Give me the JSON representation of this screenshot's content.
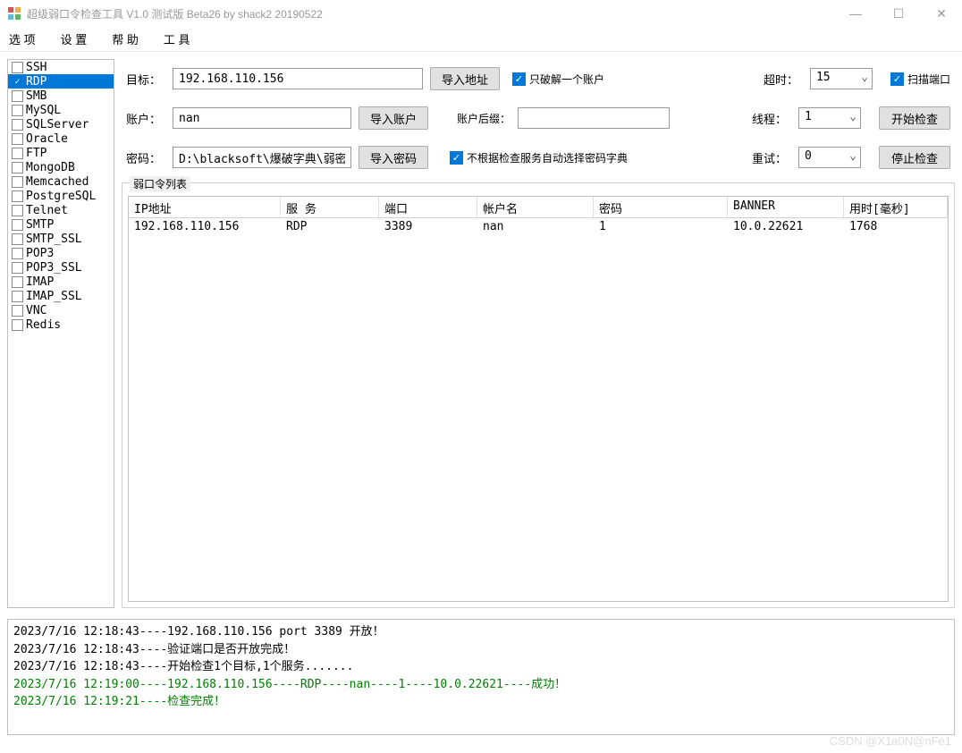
{
  "window": {
    "title": "超级弱口令检查工具 V1.0 测试版 Beta26 by shack2 20190522"
  },
  "menu": {
    "options": "选 项",
    "settings": "设 置",
    "help": "帮 助",
    "tools": "工 具"
  },
  "protocols": [
    {
      "label": "SSH",
      "checked": false,
      "selected": false
    },
    {
      "label": "RDP",
      "checked": true,
      "selected": true
    },
    {
      "label": "SMB",
      "checked": false,
      "selected": false
    },
    {
      "label": "MySQL",
      "checked": false,
      "selected": false
    },
    {
      "label": "SQLServer",
      "checked": false,
      "selected": false
    },
    {
      "label": "Oracle",
      "checked": false,
      "selected": false
    },
    {
      "label": "FTP",
      "checked": false,
      "selected": false
    },
    {
      "label": "MongoDB",
      "checked": false,
      "selected": false
    },
    {
      "label": "Memcached",
      "checked": false,
      "selected": false
    },
    {
      "label": "PostgreSQL",
      "checked": false,
      "selected": false
    },
    {
      "label": "Telnet",
      "checked": false,
      "selected": false
    },
    {
      "label": "SMTP",
      "checked": false,
      "selected": false
    },
    {
      "label": "SMTP_SSL",
      "checked": false,
      "selected": false
    },
    {
      "label": "POP3",
      "checked": false,
      "selected": false
    },
    {
      "label": "POP3_SSL",
      "checked": false,
      "selected": false
    },
    {
      "label": "IMAP",
      "checked": false,
      "selected": false
    },
    {
      "label": "IMAP_SSL",
      "checked": false,
      "selected": false
    },
    {
      "label": "VNC",
      "checked": false,
      "selected": false
    },
    {
      "label": "Redis",
      "checked": false,
      "selected": false
    }
  ],
  "form": {
    "target_label": "目标：",
    "target_value": "192.168.110.156",
    "import_target": "导入地址",
    "single_account": "只破解一个账户",
    "timeout_label": "超时：",
    "timeout_value": "15",
    "scan_port": "扫描端口",
    "user_label": "账户：",
    "user_value": "nan",
    "import_user": "导入账户",
    "user_suffix_label": "账户后缀：",
    "user_suffix_value": "",
    "threads_label": "线程：",
    "threads_value": "1",
    "start_check": "开始检查",
    "pwd_label": "密码：",
    "pwd_value": "D:\\blacksoft\\爆破字典\\弱密",
    "import_pwd": "导入密码",
    "no_auto_dict": "不根据检查服务自动选择密码字典",
    "retry_label": "重试：",
    "retry_value": "0",
    "stop_check": "停止检查"
  },
  "results": {
    "legend": "弱口令列表",
    "headers": {
      "ip": "IP地址",
      "service": "服 务",
      "port": "端口",
      "user": "帐户名",
      "pwd": "密码",
      "banner": "BANNER",
      "time": "用时[毫秒]"
    },
    "rows": [
      {
        "ip": "192.168.110.156",
        "service": "RDP",
        "port": "3389",
        "user": "nan",
        "pwd": "1",
        "banner": "10.0.22621",
        "time": "1768"
      }
    ]
  },
  "log": [
    {
      "text": "2023/7/16 12:18:43----192.168.110.156 port 3389 开放！",
      "color": "black"
    },
    {
      "text": "2023/7/16 12:18:43----验证端口是否开放完成！",
      "color": "black"
    },
    {
      "text": "2023/7/16 12:18:43----开始检查1个目标,1个服务.......",
      "color": "black"
    },
    {
      "text": "2023/7/16 12:19:00----192.168.110.156----RDP----nan----1----10.0.22621----成功！",
      "color": "green"
    },
    {
      "text": "2023/7/16 12:19:21----检查完成！",
      "color": "green"
    }
  ],
  "watermark": "CSDN @X1a0N@nFe1"
}
